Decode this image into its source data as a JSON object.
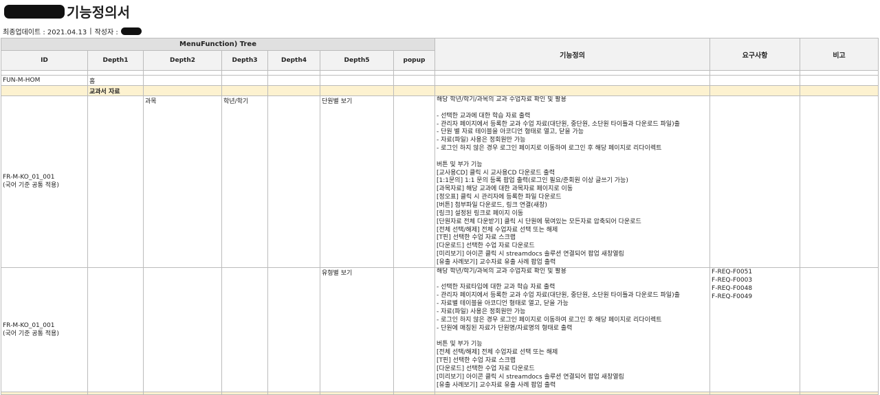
{
  "document": {
    "title": "기능정의서",
    "meta_update_label": "최종업데이트 : 2021.04.13",
    "meta_separator": "|",
    "meta_author_label": "작성자 :"
  },
  "table": {
    "tree_group_header": "MenuFunction) Tree",
    "headers": {
      "id": "ID",
      "depth1": "Depth1",
      "depth2": "Depth2",
      "depth3": "Depth3",
      "depth4": "Depth4",
      "depth5": "Depth5",
      "popup": "popup",
      "func_def": "기능정의",
      "requirements": "요구사항",
      "note": "비고"
    },
    "home_row": {
      "id": "FUN-M-HOM",
      "depth1": "홈"
    },
    "category_row": {
      "depth1": "교과서 자료"
    },
    "rows": [
      {
        "id": "FR-M-KO_01_001",
        "id_sub": "(국어 기준 공통 적용)",
        "depth2": "과목",
        "depth3": "학년/학기",
        "depth5": "단원별 보기",
        "description": "해당 학년/학기/과목의 교과 수업자료 확인 및 활용\n\n- 선택한 교과에 대한 학습 자료 출력\n- 관리자 페이지에서 등록한 교과 수업 자료(대단원, 중단원, 소단원 타이틀과 다운로드 파일)출\n- 단원 별 자료 테이블을 아코디언 형태로 열고, 닫을 가능\n- 자료(파일) 사용은 정회원만 가능\n- 로그인 하지 않은 경우 로그인 페이지로 이동하여 로그인 후 해당 페이지로 리다이렉트\n\n버튼 및 부가 기능\n[교사용CD] 클릭 시 교사용CD 다운로드 출력\n[1:1문의] 1:1 문의 등록 팝업 출력(로그인 필요/준회원 이상 글쓰기 가능)\n[과목자료] 해당 교과에 대한 과목자료 페이지로 이동\n[정오표] 클릭 시 관리자에 등록한 파일 다운로드\n[버튼] 첨부파일 다운로드, 링크 연결(새창)\n[링크] 설정된 링크로 페이지 이동\n[단원자료 전체 다운받기] 클릭 시 단원에 묶여있는 모든자료 압축되어 다운로드\n[전체 선택/해제] 전체 수업자료 선택 또는 해제\n[T핀] 선택한 수업 자료 스크랩\n[다운로드] 선택한 수업 자료 다운로드\n[미리보기] 아이콘 클릭 시 streamdocs 솔루션 연결되어 팝업 새창열림\n[유출 사례보기] 교수자료 유출 사례 팝업 출력",
        "requirements": []
      },
      {
        "id": "FR-M-KO_01_001",
        "id_sub": "(국어 기준 공통 적용)",
        "depth2": "",
        "depth3": "",
        "depth5": "유형별 보기",
        "description": "해당 학년/학기/과목의 교과 수업자료 확인 및 활용\n\n- 선택한 자료타입에 대한 교과 학습 자료 출력\n- 관리자 페이지에서 등록한 교과 수업 자료(대단원, 중단원, 소단원 타이틀과 다운로드 파일)출\n- 자료별 테이블을 아코디언 형태로 열고, 닫을 가능\n- 자료(파일) 사용은 정회원만 가능\n- 로그인 하지 않은 경우 로그인 페이지로 이동하여 로그인 후 해당 페이지로 리다이렉트\n- 단원에 매칭된 자료가 단원명/자료명의 형태로 출력\n\n버튼 및 부가 기능\n[전체 선택/해제] 전체 수업자료 선택 또는 해제\n[T핀] 선택한 수업 자료 스크랩\n[다운로드] 선택한 수업 자료 다운로드\n[미리보기] 아이콘 클릭 시 streamdocs 솔루션 연결되어 팝업 새창열림\n[유출 사례보기] 교수자료 유출 사례 팝업 출력",
        "requirements": [
          "F-REQ-F0051",
          "F-REQ-F0003",
          "F-REQ-F0048",
          "F-REQ-F0049"
        ]
      }
    ]
  }
}
